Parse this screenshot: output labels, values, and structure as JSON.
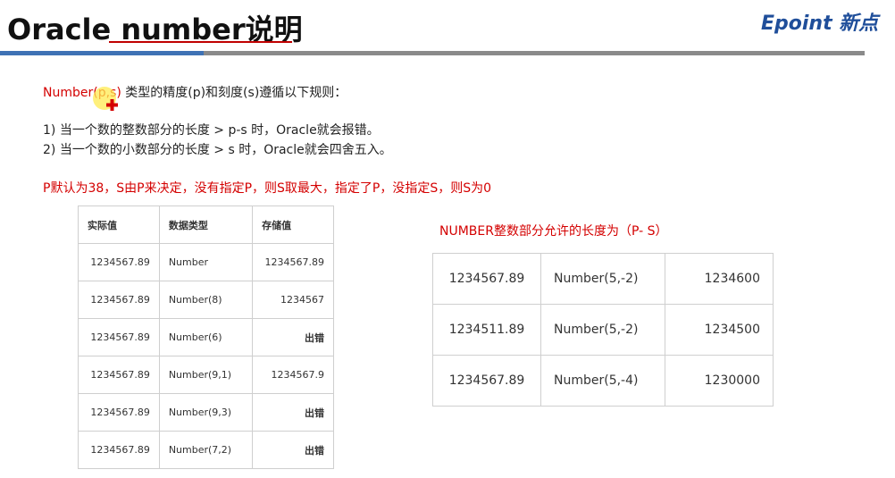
{
  "header": {
    "title": "Oracle number说明",
    "logo": "Epoint 新点",
    "colors": {
      "title_underline": "#c00000",
      "bar_blue": "#3f72b5",
      "bar_gray": "#8a8a8a",
      "logo": "#1f4e9a"
    }
  },
  "rules": {
    "intro_red": "Number(p,s)",
    "intro_rest": " 类型的精度(p)和刻度(s)遵循以下规则：",
    "rule1": "1)  当一个数的整数部分的长度 > p-s 时，Oracle就会报错。",
    "rule2": "2)  当一个数的小数部分的长度 > s 时，Oracle就会四舍五入。",
    "default_note": "P默认为38，S由P来决定，没有指定P，则S取最大，指定了P，没指定S，则S为0"
  },
  "table1": {
    "headers": [
      "实际值",
      "数据类型",
      "存储值"
    ],
    "rows": [
      [
        "1234567.89",
        "Number",
        "1234567.89"
      ],
      [
        "1234567.89",
        "Number(8)",
        "1234567"
      ],
      [
        "1234567.89",
        "Number(6)",
        "出错"
      ],
      [
        "1234567.89",
        "Number(9,1)",
        "1234567.9"
      ],
      [
        "1234567.89",
        "Number(9,3)",
        "出错"
      ],
      [
        "1234567.89",
        "Number(7,2)",
        "出错"
      ]
    ]
  },
  "table2": {
    "label": "NUMBER整数部分允许的长度为（P- S）",
    "rows": [
      [
        "1234567.89",
        "Number(5,-2)",
        "1234600"
      ],
      [
        "1234511.89",
        "Number(5,-2)",
        "1234500"
      ],
      [
        "1234567.89",
        "Number(5,-4)",
        "1230000"
      ]
    ]
  }
}
